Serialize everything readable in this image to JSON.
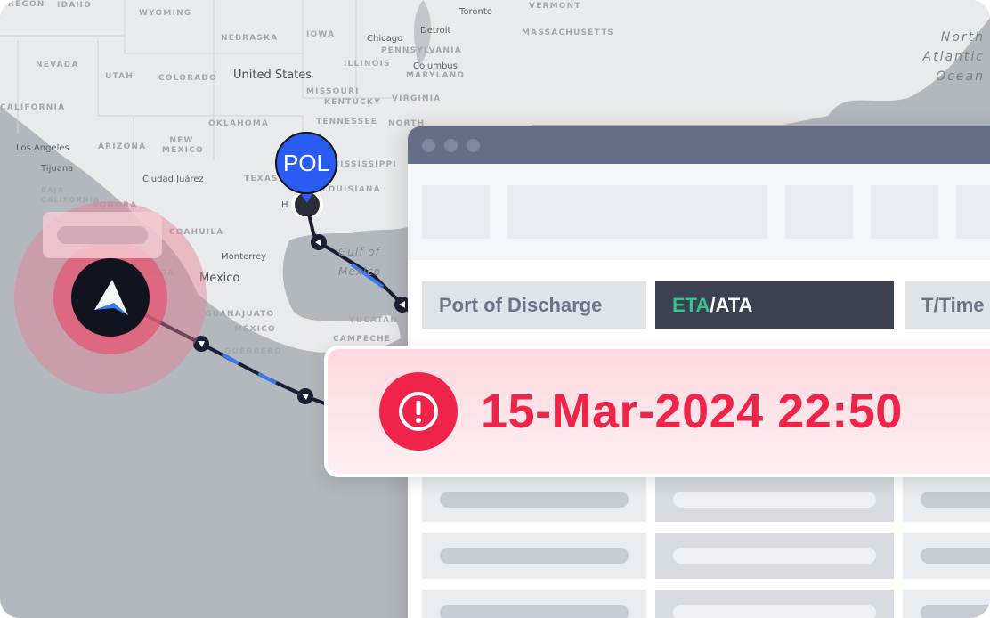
{
  "map": {
    "states": [
      "OREGON",
      "IDAHO",
      "WYOMING",
      "NEBRASKA",
      "IOWA",
      "NEVADA",
      "UTAH",
      "COLORADO",
      "ILLINOIS",
      "MISSOURI",
      "KENTUCKY",
      "CALIFORNIA",
      "ARIZONA",
      "NEW MEXICO",
      "OKLAHOMA",
      "TENNESSEE",
      "TEXAS",
      "MISSISSIPPI",
      "LOUISIANA",
      "SONORA",
      "COAHUILA",
      "GUANAJUATO",
      "MÉXICO",
      "GUERRERO",
      "YUCATÁN",
      "CAMPECHE",
      "PENNSYLVANIA",
      "MARYLAND",
      "VIRGINIA",
      "NORTH",
      "MASSACHUSETTS",
      "VERMONT",
      "BAJA CALIFORNIA",
      "SINALOA"
    ],
    "cities": [
      "Toronto",
      "Detroit",
      "Chicago",
      "Columbus",
      "Los Angeles",
      "Tijuana",
      "Ciudad Juárez",
      "Monterrey",
      "H"
    ],
    "countries": [
      "United States",
      "Mexico"
    ],
    "ocean": "North Atlantic Ocean",
    "gulf": "Gulf of Mexico",
    "pol_marker": "POL",
    "colors": {
      "land": "#e9eaeb",
      "water": "#b3b8bf",
      "route": "#1a1f33",
      "route_accent": "#3a7af0",
      "pol": "#2a5cf1",
      "alert": "#f0244b"
    }
  },
  "window": {
    "headers": {
      "port_of_discharge": "Port of Discharge",
      "eta": "ETA",
      "ata": "/ATA",
      "t_time": "T/Time"
    },
    "colors": {
      "eta": "#34c38a",
      "header_active": "#3b4150"
    }
  },
  "alert": {
    "icon": "alert-circle-icon",
    "datetime": "15-Mar-2024 22:50"
  }
}
